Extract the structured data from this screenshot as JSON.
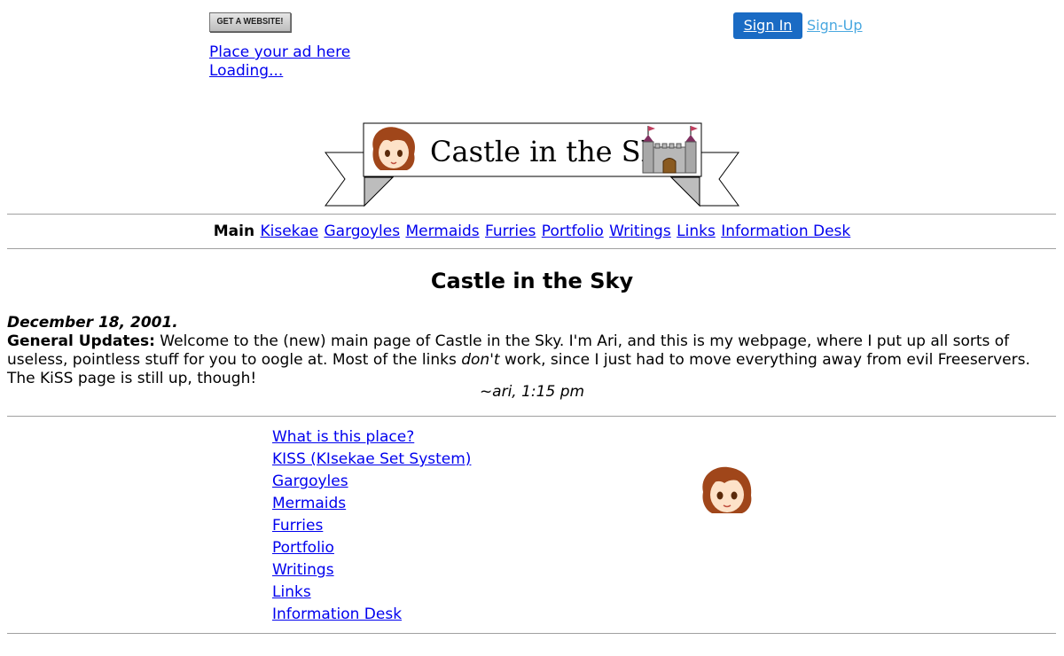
{
  "ad": {
    "button_label": "GET A WEBSITE!",
    "place_ad_link": "Place your ad here",
    "loading_link": "Loading..."
  },
  "auth": {
    "signin_label": "Sign In",
    "signup_label": "Sign-Up",
    "signin_color": "#1a6bc4",
    "signup_color": "#4aa8e0"
  },
  "banner": {
    "title": "Castle in the Sky"
  },
  "nav": {
    "current": "Main",
    "links": [
      "Kisekae",
      "Gargoyles",
      "Mermaids",
      "Furries",
      "Portfolio",
      "Writings",
      "Links",
      "Information Desk"
    ]
  },
  "page": {
    "heading": "Castle in the Sky",
    "date": "December 18, 2001.",
    "updates_label": "General Updates:",
    "updates_text_1": " Welcome to the (new) main page of Castle in the Sky. I'm Ari, and this is my webpage, where I put up all sorts of useless, pointless stuff for you to oogle at. Most of the links ",
    "updates_emph": "don't",
    "updates_text_2": " work, since I just had to move everything away from evil Freeservers. The KiSS page is still up, though!",
    "signature": "~ari, 1:15 pm"
  },
  "links": [
    "What is this place?",
    "KISS (KIsekae Set System)",
    "Gargoyles",
    "Mermaids",
    "Furries",
    "Portfolio",
    "Writings",
    "Links",
    "Information Desk"
  ],
  "icons": {
    "banner_face": "anime-girl-face-icon",
    "banner_castle": "castle-icon",
    "side_face": "anime-girl-face-icon"
  }
}
